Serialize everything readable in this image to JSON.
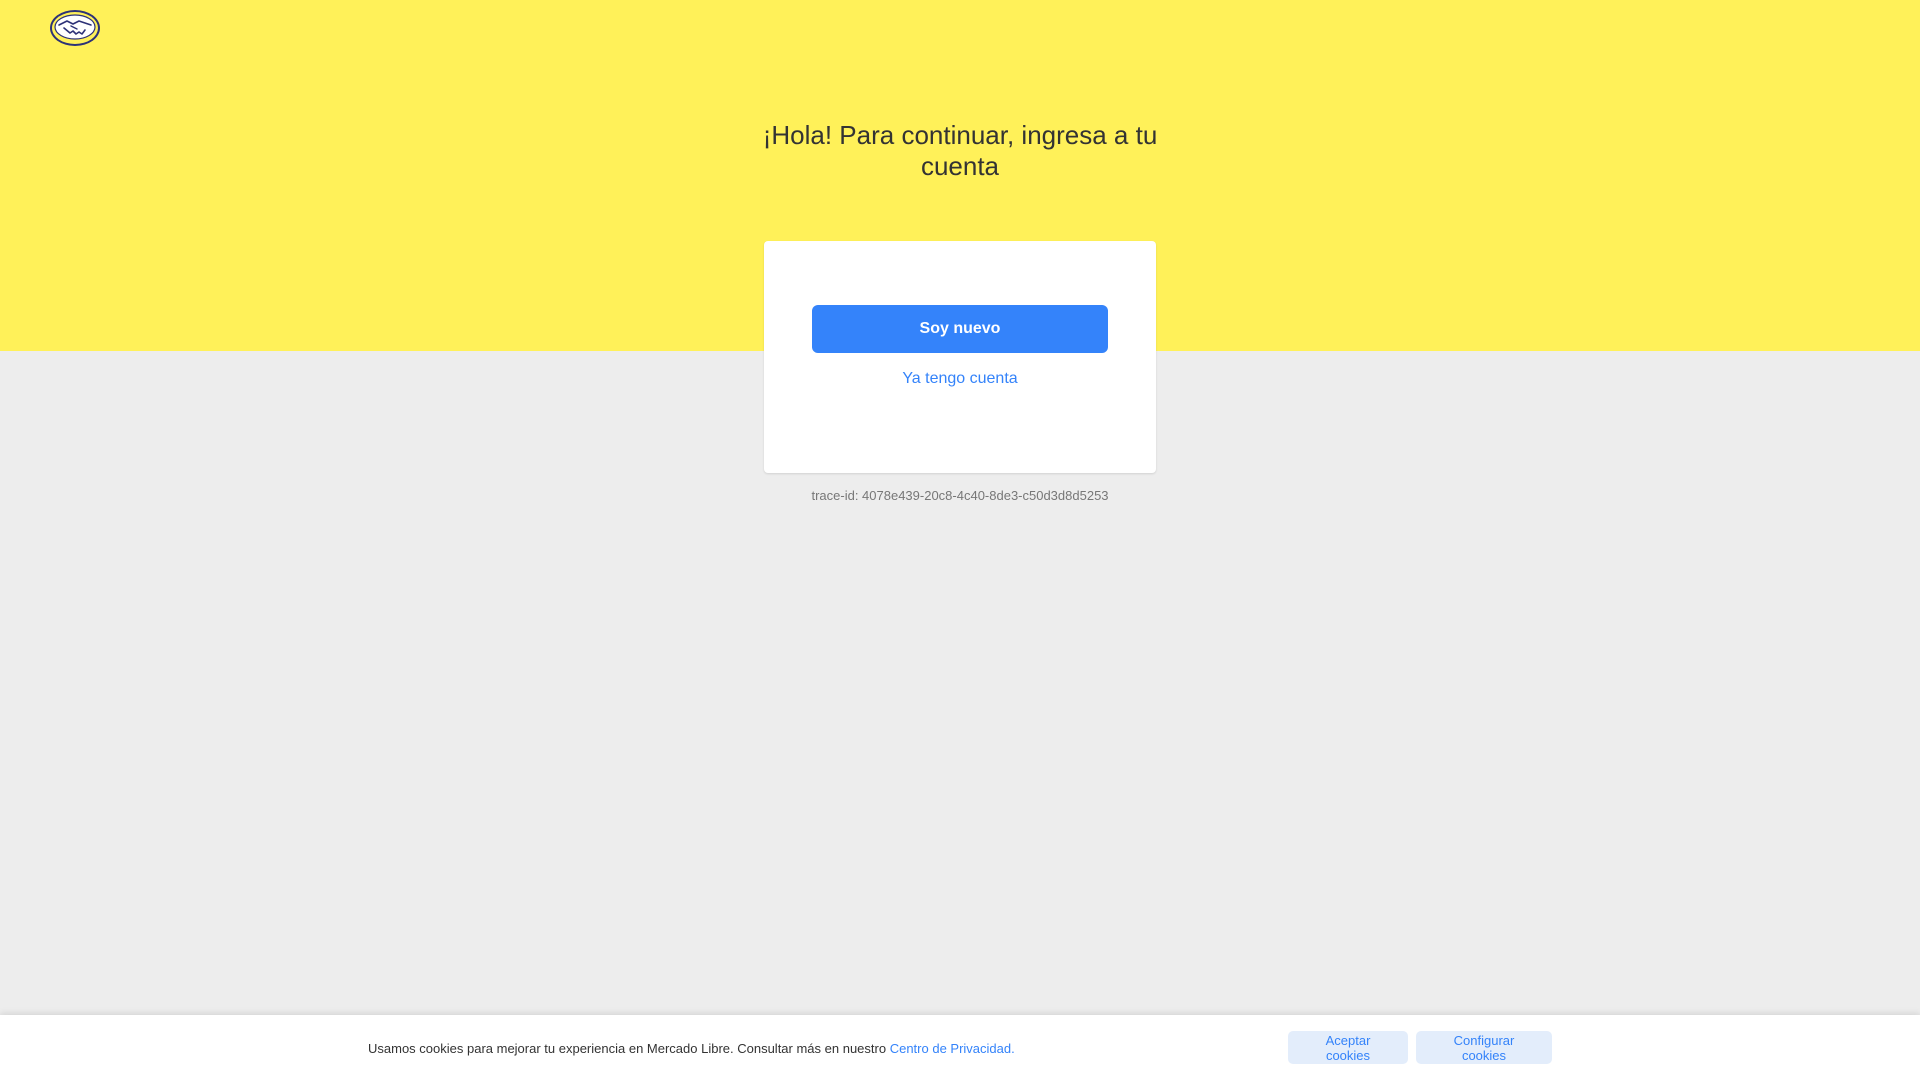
{
  "header": {
    "logo_icon": "mercadolibre-handshake-logo-icon"
  },
  "login": {
    "title": "¡Hola! Para continuar, ingresa a tu cuenta",
    "new_user_label": "Soy nuevo",
    "existing_user_label": "Ya tengo cuenta",
    "trace_id": "trace-id: 4078e439-20c8-4c40-8de3-c50d3d8d5253"
  },
  "cookies": {
    "message": "Usamos cookies para mejorar tu experiencia en Mercado Libre. Consultar más en nuestro",
    "privacy_link": "Centro de Privacidad.",
    "accept_label": "Aceptar cookies",
    "configure_label": "Configurar cookies"
  },
  "colors": {
    "hero_yellow": "#fff159",
    "background_gray": "#ededed",
    "accent_blue": "#3483fa",
    "secondary_button_bg": "#e3edfb"
  }
}
